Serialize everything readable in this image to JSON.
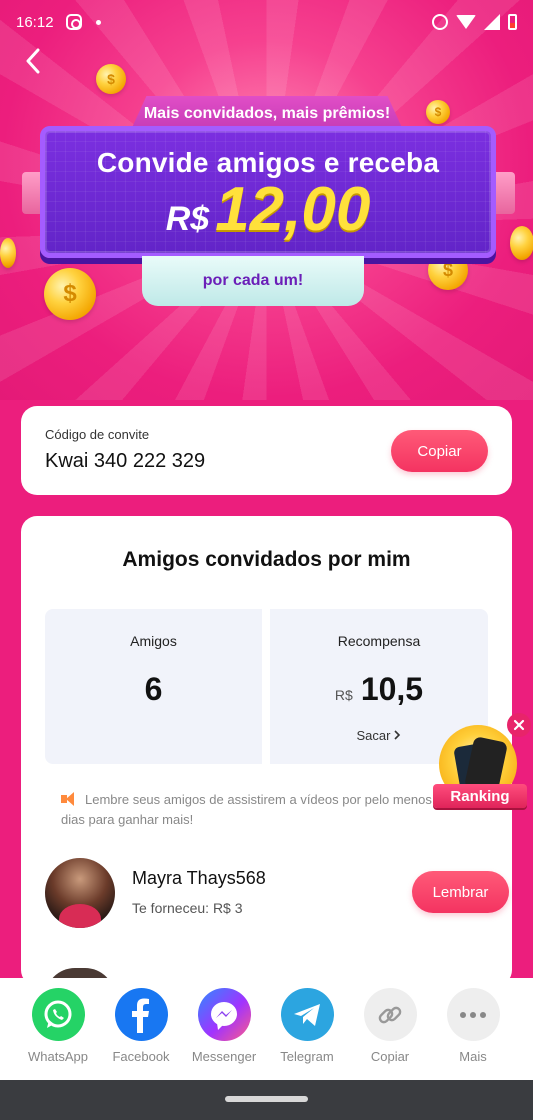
{
  "status_bar": {
    "time": "16:12"
  },
  "banner": {
    "top_label": "Mais convidados, mais prêmios!",
    "line1": "Convide amigos e receba",
    "currency": "R$",
    "amount": "12,00",
    "ribbon": "por cada um!"
  },
  "invite": {
    "label": "Código de convite",
    "code": "Kwai 340 222 329",
    "copy_button": "Copiar"
  },
  "friends_section": {
    "title": "Amigos convidados por mim",
    "friends_label": "Amigos",
    "friends_count": "6",
    "reward_label": "Recompensa",
    "reward_currency": "R$",
    "reward_value": "10,5",
    "withdraw_label": "Sacar",
    "reminder": "Lembre seus amigos de assistirem a vídeos por pelo menos 10,00 dias para ganhar mais!",
    "friend": {
      "name": "Mayra Thays568",
      "contribution": "Te forneceu: R$ 3",
      "remind_button": "Lembrar"
    }
  },
  "ranking": {
    "label": "Ranking"
  },
  "share": [
    {
      "label": "WhatsApp",
      "icon": "whatsapp-icon",
      "color": "#25d366"
    },
    {
      "label": "Facebook",
      "icon": "facebook-icon",
      "color": "#1877f2"
    },
    {
      "label": "Messenger",
      "icon": "messenger-icon",
      "color": "#8a3ff0"
    },
    {
      "label": "Telegram",
      "icon": "telegram-icon",
      "color": "#2ca5e0"
    },
    {
      "label": "Copiar",
      "icon": "link-icon",
      "color": "#eeeeee"
    },
    {
      "label": "Mais",
      "icon": "more-icon",
      "color": "#eeeeee"
    }
  ],
  "colors": {
    "background": "#ec1e7d",
    "accent_button": "#f43361",
    "amount": "#ffe13b"
  }
}
